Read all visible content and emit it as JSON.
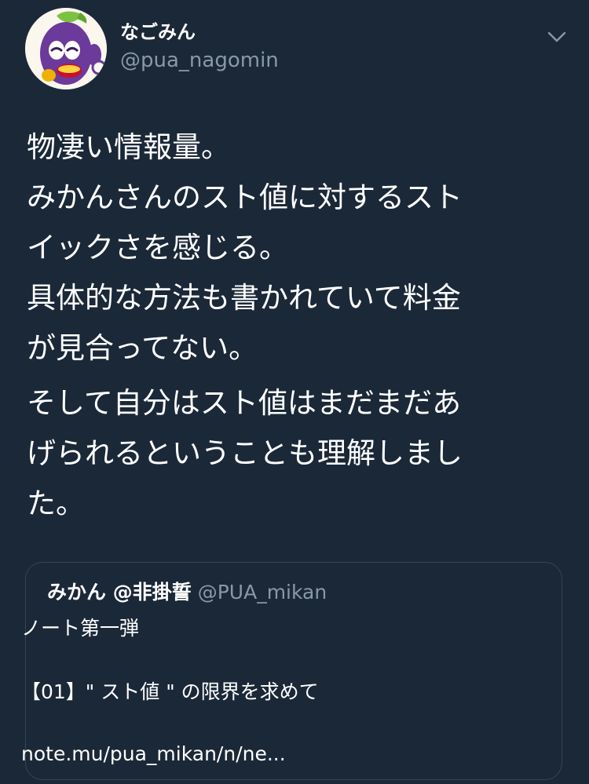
{
  "tweet": {
    "author": {
      "display_name": "なごみん",
      "handle": "@pua_nagomin",
      "avatar": "eggplant-mascot-avatar"
    },
    "menu_icon": "chevron-down-icon",
    "body_lines": [
      "物凄い情報量。",
      "みかんさんのスト値に対するスト",
      "イックさを感じる。",
      "具体的な方法も書かれていて料金",
      "が見合ってない。"
    ],
    "body_lines_2": [
      "そして自分はスト値はまだまだあ",
      "げられるということも理解しまし",
      "た。"
    ],
    "quoted": {
      "name": "みかん @非掛誓",
      "handle": "@PUA_mikan",
      "line1": "ノート第一弾",
      "line2": "【01】\" スト値 \" の限界を求めて",
      "link": "note.mu/pua_mikan/n/ne..."
    }
  },
  "colors": {
    "background": "#1b2838",
    "text": "#ffffff",
    "secondary_text": "#8899a6",
    "border": "#38444d"
  }
}
